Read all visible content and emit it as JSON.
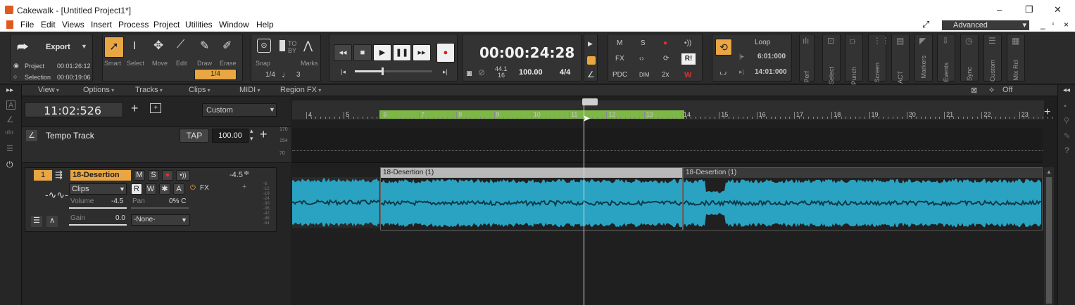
{
  "window": {
    "title": "Cakewalk - [Untitled Project1*]",
    "minimize": "–",
    "restore": "❐",
    "close": "✕"
  },
  "menu": {
    "items": [
      "File",
      "Edit",
      "Views",
      "Insert",
      "Process",
      "Project",
      "Utilities",
      "Window",
      "Help"
    ],
    "workspace": "Advanced"
  },
  "export_module": {
    "export_label": "Export",
    "project_label": "Project",
    "project_time": "00:01:26:12",
    "selection_label": "Selection",
    "selection_time": "00:00:19:06"
  },
  "tools": {
    "labels": [
      "Smart",
      "Select",
      "Move",
      "Edit",
      "Draw",
      "Erase"
    ],
    "snap_value": "1/4"
  },
  "snap_module": {
    "snap_label": "Snap",
    "marks_label": "Marks",
    "to_label": "TO",
    "by_label": "BY",
    "resolution": "1/4",
    "triplet": "3"
  },
  "transport": {
    "time": "00:00:24:28",
    "sample_rate_top": "44.1",
    "sample_rate_bottom": "16",
    "tempo": "100.00",
    "meter": "4/4"
  },
  "mix_module": {
    "row1": [
      "M",
      "S",
      "●",
      "•))"
    ],
    "row2": [
      "FX",
      "‹›",
      "⟳",
      "R!"
    ],
    "row3": [
      "PDC",
      "DIM",
      "2x",
      "W"
    ]
  },
  "loop_module": {
    "title": "Loop",
    "start": "6:01:000",
    "end": "14:01:000"
  },
  "modules": [
    "Perf",
    "Select",
    "Punch",
    "Screen",
    "ACT",
    "Markers",
    "Events",
    "Sync",
    "Custom",
    "Mix Rcl"
  ],
  "view_menu": {
    "items": [
      "View",
      "Options",
      "Tracks",
      "Clips",
      "MIDI",
      "Region FX"
    ],
    "snap_state": "Off"
  },
  "track_header": {
    "now_time": "11:02:526",
    "display_mode": "Custom"
  },
  "tempo_track": {
    "name": "Tempo Track",
    "tap_label": "TAP",
    "tempo_value": "100.00",
    "scale_170": "170",
    "scale_154": "154",
    "scale_70": "70"
  },
  "audio_track": {
    "number": "1",
    "name": "18-Desertion (1)",
    "mute": "M",
    "solo": "S",
    "peak": "-4.5",
    "clips_mode": "Clips",
    "read": "R",
    "write": "W",
    "fx_label": "FX",
    "volume_label": "Volume",
    "volume_value": "-4.5",
    "pan_label": "Pan",
    "pan_value": "0% C",
    "gain_label": "Gain",
    "gain_value": "0.0",
    "output": "-None-",
    "meter_scale": [
      "-6",
      "-12",
      "-18",
      "-24",
      "-30",
      "-36",
      "-42",
      "-48",
      "-54"
    ]
  },
  "timeline": {
    "bars": [
      "4",
      "5",
      "6",
      "7",
      "8",
      "9",
      "10",
      "11",
      "12",
      "13",
      "14",
      "15",
      "16",
      "17",
      "18",
      "19",
      "20",
      "21",
      "22",
      "23"
    ]
  },
  "clips": [
    {
      "name": "18-Desertion (1)"
    },
    {
      "name": "18-Desertion (1)"
    }
  ],
  "colors": {
    "accent": "#e9a642",
    "waveform": "#2aa3c2",
    "loop_region": "#8bcf4a"
  }
}
